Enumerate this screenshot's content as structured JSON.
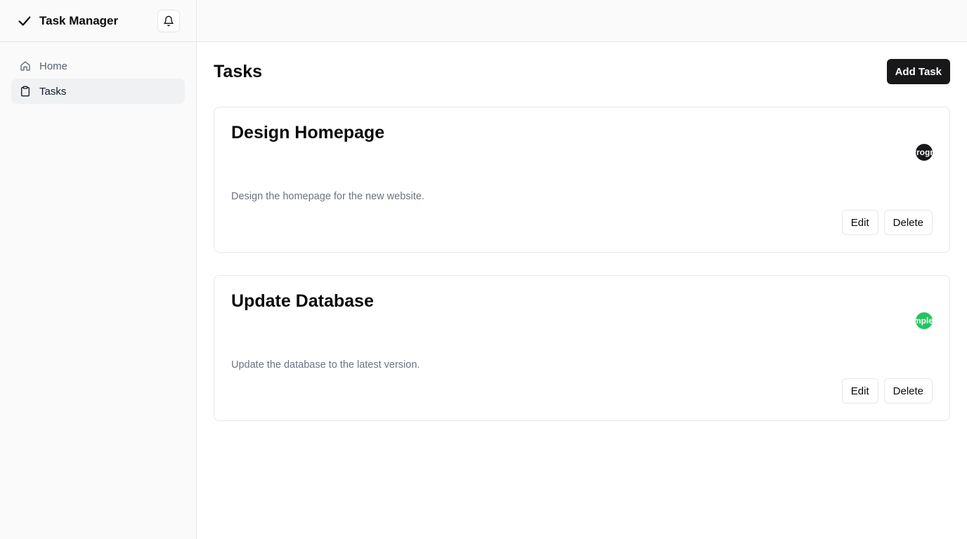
{
  "app": {
    "title": "Task Manager"
  },
  "sidebar": {
    "items": [
      {
        "label": "Home",
        "icon": "home-icon",
        "active": false
      },
      {
        "label": "Tasks",
        "icon": "clipboard-icon",
        "active": true
      }
    ]
  },
  "main": {
    "title": "Tasks",
    "add_button": "Add Task",
    "tasks": [
      {
        "title": "Design Homepage",
        "description": "Design the homepage for the new website.",
        "status": "In Progress",
        "status_color": "#18181b",
        "edit_label": "Edit",
        "delete_label": "Delete"
      },
      {
        "title": "Update Database",
        "description": "Update the database to the latest version.",
        "status": "Completed",
        "status_color": "#22c55e",
        "edit_label": "Edit",
        "delete_label": "Delete"
      }
    ]
  },
  "colors": {
    "primary": "#18181b",
    "success": "#22c55e",
    "sidebar_bg": "#f9faf9",
    "border": "#e5e7eb"
  }
}
